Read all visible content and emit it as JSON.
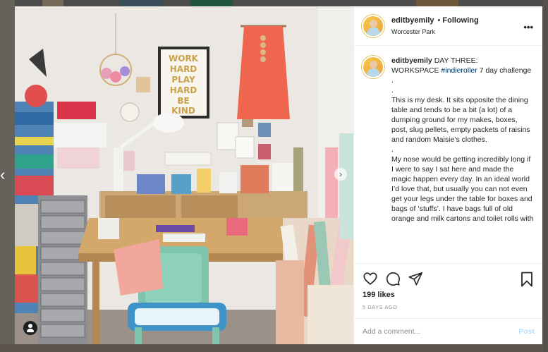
{
  "post": {
    "username": "editbyemily",
    "separator": "•",
    "follow_status": "Following",
    "location": "Worcester Park",
    "more_icon": "more-horizontal-icon",
    "caption_lines": [
      " DAY THREE:",
      "WORKSPACE ",
      "#indieroller",
      " 7 day challenge",
      ".",
      ".",
      "This is my desk. It sits opposite the dining table and tends to be a bit (a lot) of a dumping ground for my makes, boxes, post, slug pellets, empty packets of raisins and random Maisie’s clothes.",
      ".",
      "My nose would be getting incredibly long if I were to say I sat here and made the magic happen every day. In an ideal world I’d love that, but usually you can not even get your legs under the table for boxes and bags of ‘stuffs’. I have bags full of old orange and milk cartons and toilet rolls with"
    ],
    "likes": "199 likes",
    "date": "5 DAYS AGO",
    "comment_placeholder": "Add a comment...",
    "post_label": "Post"
  },
  "icons": {
    "like": "heart-icon",
    "comment": "comment-icon",
    "share": "paper-plane-icon",
    "save": "bookmark-icon",
    "prev": "chevron-left-icon",
    "next": "chevron-right-icon",
    "tagged_user": "user-tag-icon"
  },
  "photo_text": {
    "poster_lines": [
      "WORK",
      "HARD",
      "PLAY",
      "HARD",
      "BE",
      "KIND"
    ]
  },
  "colors": {
    "link": "#00376b",
    "post_disabled": "#b2dffc",
    "muted": "#8e8e8e"
  }
}
